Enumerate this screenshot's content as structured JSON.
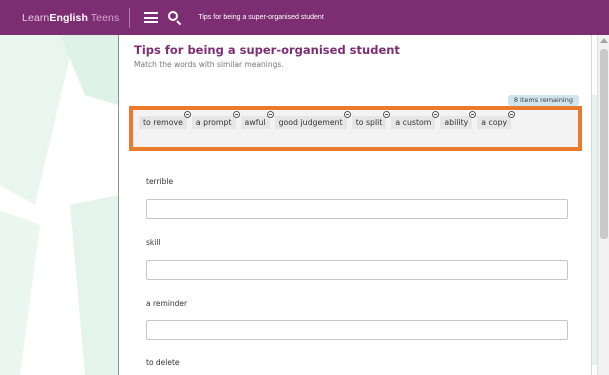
{
  "header": {
    "logo_prefix": "Learn",
    "logo_brand": "English",
    "logo_suffix": " Teens",
    "title": "Tips for being a super-organised student",
    "menu_icon": "hamburger-menu-icon",
    "search_icon": "search-icon"
  },
  "activity": {
    "title": "Tips for being a super-organised student",
    "instruction": "Match the words with similar meanings.",
    "remaining": "8 items remaining",
    "chips": [
      "to remove",
      "a prompt",
      "awful",
      "good judgement",
      "to split",
      "a custom",
      "ability",
      "a copy"
    ],
    "questions": [
      {
        "label": "terrible",
        "value": ""
      },
      {
        "label": "skill",
        "value": ""
      },
      {
        "label": "a reminder",
        "value": ""
      },
      {
        "label": "to delete",
        "value": ""
      }
    ]
  },
  "colors": {
    "brand_purple": "#7d2e73",
    "highlight_orange": "#ec7a2d",
    "badge_blue": "#cfe4ec",
    "chip_grey": "#e6e6e6"
  }
}
